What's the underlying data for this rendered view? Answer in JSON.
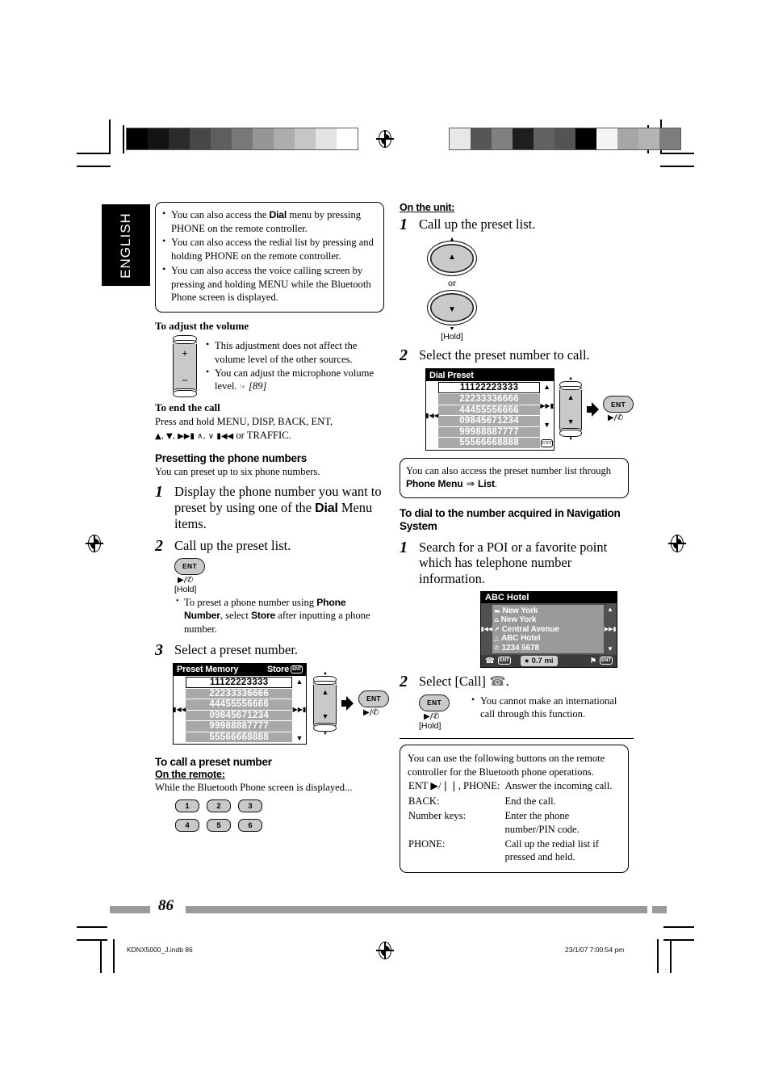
{
  "page": {
    "language_tab": "ENGLISH",
    "page_number": "86",
    "footer_file": "KDNX5000_J.indb   86",
    "footer_date": "23/1/07   7:00:54 pm"
  },
  "left_column": {
    "top_note": {
      "bullets": [
        {
          "pre": "You can also access the ",
          "strong": "Dial",
          "post": " menu by pressing PHONE on the remote controller."
        },
        {
          "pre": "You can also access the redial list by pressing and holding PHONE on the remote controller.",
          "strong": "",
          "post": ""
        },
        {
          "pre": "You can also access the voice calling screen by pressing and holding MENU while the Bluetooth Phone screen is displayed.",
          "strong": "",
          "post": ""
        }
      ]
    },
    "volume": {
      "heading": "To adjust the volume",
      "plus": "+",
      "minus": "–",
      "bullets": [
        "This adjustment does not affect the volume level of the other sources.",
        "You can adjust the microphone volume level."
      ],
      "ref": "[89]"
    },
    "end_call": {
      "heading": "To end the call",
      "line1": "Press and hold MENU, DISP, BACK, ENT,",
      "line2_glyphs": "▲, ▼, ▶▶▮ ∧, ∨ ▮◀◀",
      "line2_tail": " or TRAFFIC."
    },
    "presetting": {
      "heading": "Presetting the phone numbers",
      "intro": "You can preset up to six phone numbers.",
      "step1_num": "1",
      "step1_a": "Display the phone number you want to preset by using one of the ",
      "step1_strong": "Dial",
      "step1_b": " Menu items.",
      "step2_num": "2",
      "step2": "Call up the preset list.",
      "ent_label": "ENT",
      "play_glyph": "▶/✆",
      "hold": "[Hold]",
      "note_pre": "To preset a phone number using ",
      "note_strong1": "Phone Number",
      "note_mid": ", select ",
      "note_strong2": "Store",
      "note_post": " after inputting a phone number.",
      "step3_num": "3",
      "step3": "Select a preset number."
    },
    "preset_memory_screen": {
      "title": "Preset Memory",
      "action": "Store",
      "action_key": "ENT",
      "prev_icon": "▮◀◀",
      "next_icon": "▶▶▮",
      "up_icon": "▲",
      "down_icon": "▼",
      "rows": [
        "11122223333",
        "22233336666",
        "44455556666",
        "09845671234",
        "99988887777",
        "55566668888"
      ],
      "selected_index": 0,
      "ent_key": "ENT",
      "play_glyph": "▶/✆"
    },
    "call_preset": {
      "heading": "To call a preset number",
      "subheading": "On the remote:",
      "intro": "While the Bluetooth Phone screen is displayed...",
      "keys_row1": [
        "1",
        "2",
        "3"
      ],
      "keys_row2": [
        "4",
        "5",
        "6"
      ]
    }
  },
  "right_column": {
    "on_unit": {
      "subheading": "On the unit:",
      "step1_num": "1",
      "step1": "Call up the preset list.",
      "or": "or",
      "hold": "[Hold]",
      "up_icon": "▲",
      "down_icon": "▼",
      "step2_num": "2",
      "step2": "Select the preset number to call."
    },
    "dial_preset_screen": {
      "title": "Dial Preset",
      "prev_icon": "▮◀◀",
      "next_icon": "▶▶▮",
      "up_icon": "▲",
      "down_icon": "▼",
      "ent_badge": "ENT",
      "rows": [
        "11122223333",
        "22233336666",
        "44455556666",
        "09845671234",
        "99988887777",
        "55566668888"
      ],
      "selected_index": 0,
      "ent_key": "ENT",
      "play_glyph": "▶/✆"
    },
    "preset_note": {
      "pre": "You can also access the preset number list through ",
      "strong1": "Phone Menu",
      "arrow": " ⇒ ",
      "strong2": "List",
      "post": "."
    },
    "navigation": {
      "heading": "To dial to the number acquired in Navigation System",
      "step1_num": "1",
      "step1": "Search for a POI or a favorite point which has telephone number information.",
      "step2_num": "2",
      "step2_pre": "Select [Call]",
      "step2_post": ".",
      "ent_key": "ENT",
      "play_glyph": "▶/✆",
      "hold": "[Hold]",
      "bullet": "You cannot make an international call through this function."
    },
    "poi_screen": {
      "title": "ABC Hotel",
      "prev_icon": "▮◀◀",
      "next_icon": "▶▶▮",
      "up_icon": "▲",
      "down_icon": "▼",
      "rows": [
        {
          "icon": "state-icon",
          "glyph": "▬",
          "label": "New York"
        },
        {
          "icon": "city-icon",
          "glyph": "⌂",
          "label": "New York"
        },
        {
          "icon": "street-icon",
          "glyph": "↗",
          "label": "Central Avenue"
        },
        {
          "icon": "poi-icon",
          "glyph": "△",
          "label": "ABC Hotel"
        },
        {
          "icon": "phone-icon",
          "glyph": "✆",
          "label": "1234 5678"
        }
      ],
      "bottom": {
        "call_icon": "phone-icon",
        "call_key": "ENT",
        "distance_icon": "route-icon",
        "distance": "0.7 mi",
        "goal_icon": "checkered-flag-icon",
        "goal_key": "ENT"
      }
    },
    "remote_note": {
      "lines": [
        "You can use the following buttons on the remote controller for the Bluetooth phone operations."
      ],
      "rows": [
        {
          "key": "ENT ▶/❘❘, PHONE:",
          "desc": "Answer the incoming call."
        },
        {
          "key": "BACK:",
          "desc": "End the call."
        },
        {
          "key": "Number keys:",
          "desc": "Enter the phone number/PIN code."
        },
        {
          "key": "PHONE:",
          "desc": "Call up the redial list if pressed and held."
        }
      ]
    }
  },
  "calibration": {
    "left_bar": [
      "#000000",
      "#141414",
      "#2b2b2b",
      "#474747",
      "#5e5e5e",
      "#787878",
      "#969696",
      "#adadad",
      "#c6c6c6",
      "#e4e4e4",
      "#ffffff"
    ],
    "right_bar": [
      "#e8e8e8",
      "#565656",
      "#808080",
      "#1e1e1e",
      "#626262",
      "#545454",
      "#000000",
      "#f4f4f4",
      "#a6a6a6",
      "#b4b4b4",
      "#7e7e7e"
    ]
  }
}
